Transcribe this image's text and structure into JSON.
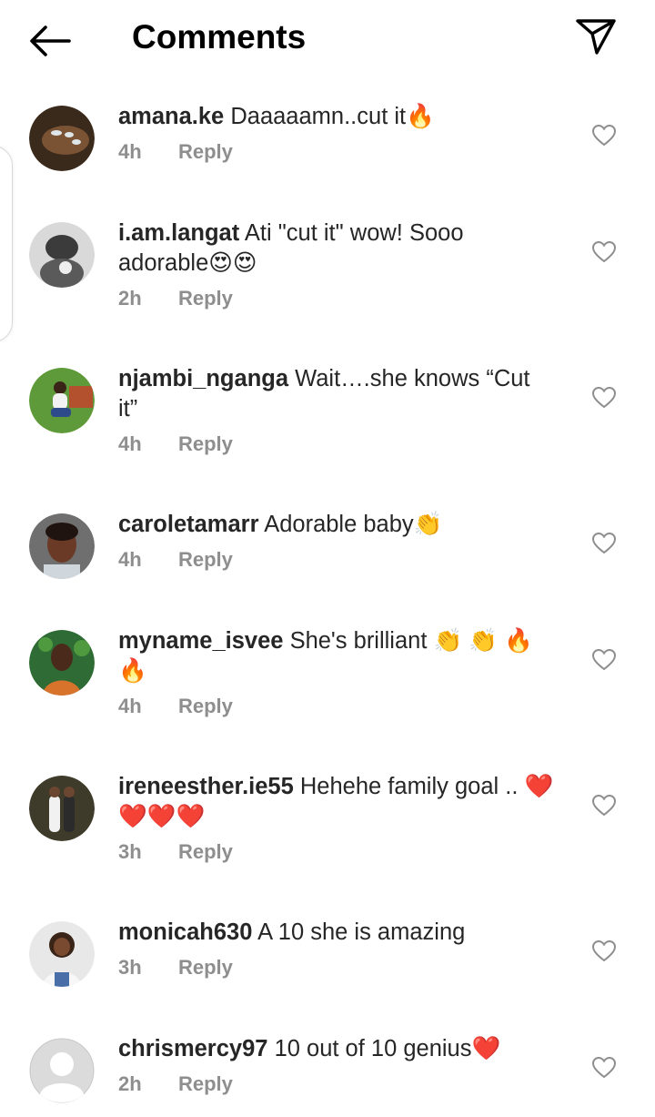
{
  "header": {
    "title": "Comments"
  },
  "comments": [
    {
      "username": "amana.ke",
      "text": "Daaaaamn..cut it🔥",
      "time": "4h",
      "reply_label": "Reply"
    },
    {
      "username": "i.am.langat",
      "text": "Ati \"cut it\" wow! Sooo adorable😍😍",
      "time": "2h",
      "reply_label": "Reply"
    },
    {
      "username": "njambi_nganga",
      "text": "Wait….she knows “Cut it”",
      "time": "4h",
      "reply_label": "Reply"
    },
    {
      "username": "caroletamarr",
      "text": "Adorable baby👏",
      "time": "4h",
      "reply_label": "Reply"
    },
    {
      "username": "myname_isvee",
      "text": "She's brilliant 👏 👏 🔥 🔥",
      "time": "4h",
      "reply_label": "Reply"
    },
    {
      "username": "ireneesther.ie55",
      "text": "Hehehe family goal .. ❤️❤️❤️❤️",
      "time": "3h",
      "reply_label": "Reply"
    },
    {
      "username": "monicah630",
      "text": "A 10 she is amazing",
      "time": "3h",
      "reply_label": "Reply"
    },
    {
      "username": "chrismercy97",
      "text": "10 out of 10 genius❤️",
      "time": "2h",
      "reply_label": "Reply"
    }
  ],
  "icons": {
    "back": "arrow-left-icon",
    "send": "paper-plane-icon",
    "like": "heart-outline-icon"
  }
}
